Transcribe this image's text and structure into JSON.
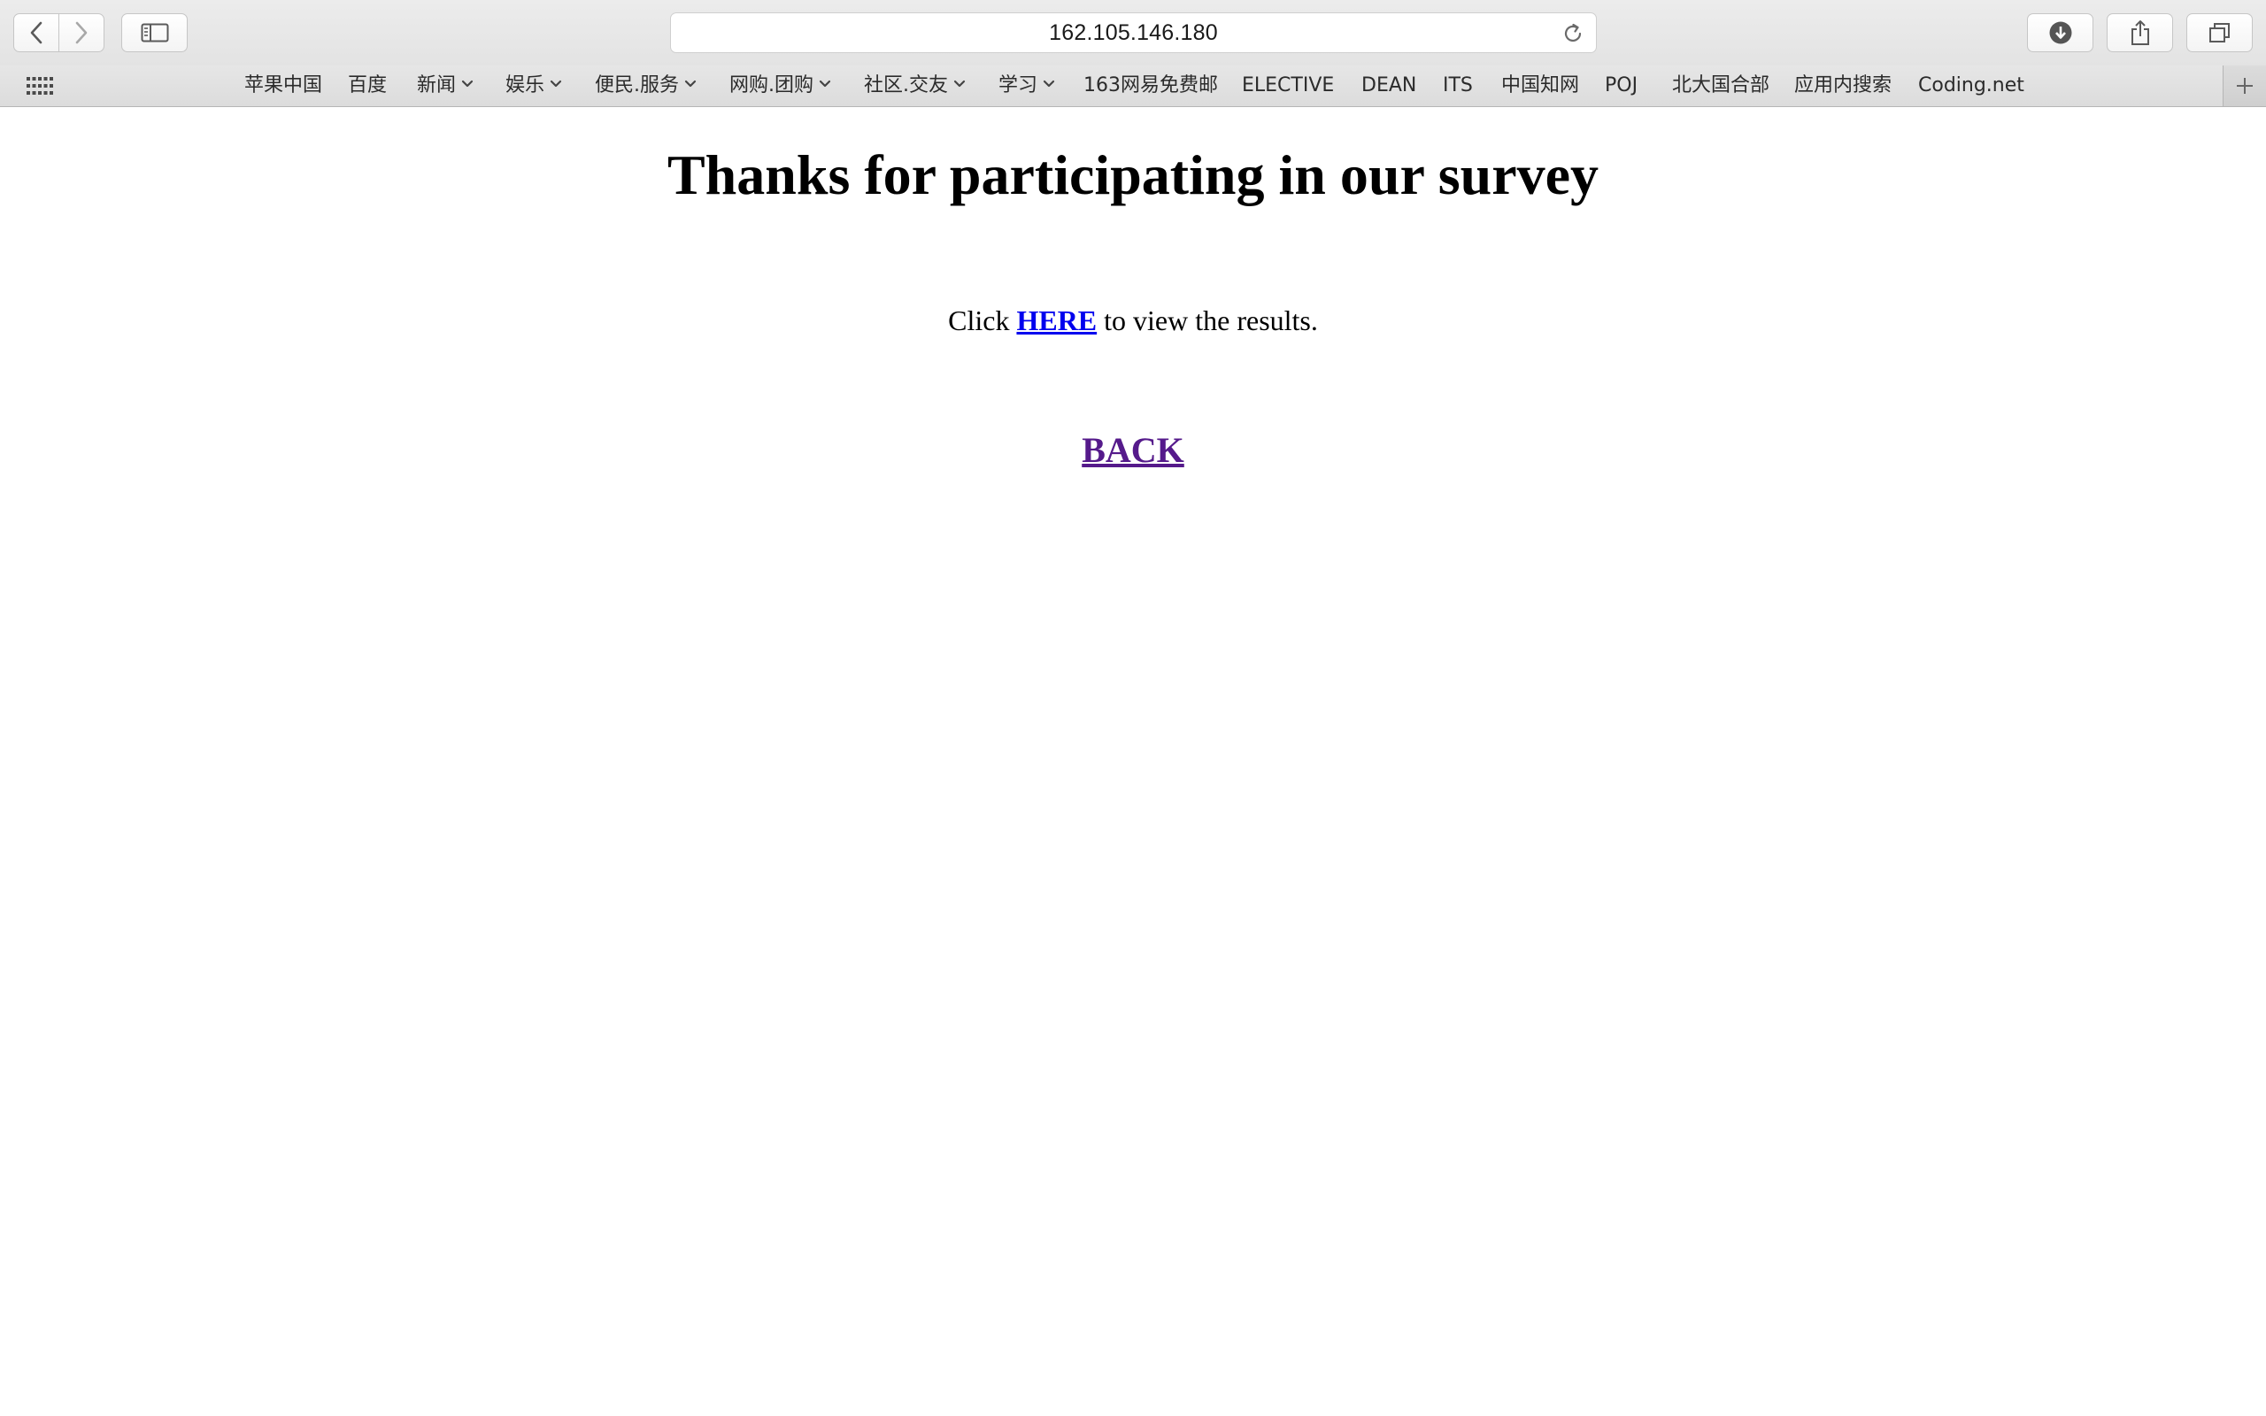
{
  "browser": {
    "address": "162.105.146.180",
    "bookmarks": [
      {
        "label": "苹果中国",
        "menu": false
      },
      {
        "label": "百度",
        "menu": false
      },
      {
        "label": "新闻",
        "menu": true
      },
      {
        "label": "娱乐",
        "menu": true
      },
      {
        "label": "便民.服务",
        "menu": true
      },
      {
        "label": "网购.团购",
        "menu": true
      },
      {
        "label": "社区.交友",
        "menu": true
      },
      {
        "label": "学习",
        "menu": true
      },
      {
        "label": "163网易免费邮",
        "menu": false
      },
      {
        "label": "ELECTIVE",
        "menu": false
      },
      {
        "label": "DEAN",
        "menu": false
      },
      {
        "label": "ITS",
        "menu": false
      },
      {
        "label": "中国知网",
        "menu": false
      },
      {
        "label": "POJ",
        "menu": false
      },
      {
        "label": "北大国合部",
        "menu": false
      },
      {
        "label": "应用内搜索",
        "menu": false
      },
      {
        "label": "Coding.net",
        "menu": false
      }
    ],
    "icons": {
      "back": "chevron-left-icon",
      "forward": "chevron-right-icon",
      "sidebar": "sidebar-icon",
      "reload": "reload-icon",
      "downloads": "download-icon",
      "share": "share-icon",
      "tabs": "tabs-icon",
      "apps": "grid-icon",
      "add": "plus-icon"
    }
  },
  "page": {
    "title": "Thanks for participating in our survey",
    "results_prefix": "Click ",
    "results_link": "HERE",
    "results_suffix": " to view the results.",
    "back_link": "BACK",
    "colors": {
      "link": "#0000ee",
      "visited_link": "#551a8b"
    }
  }
}
